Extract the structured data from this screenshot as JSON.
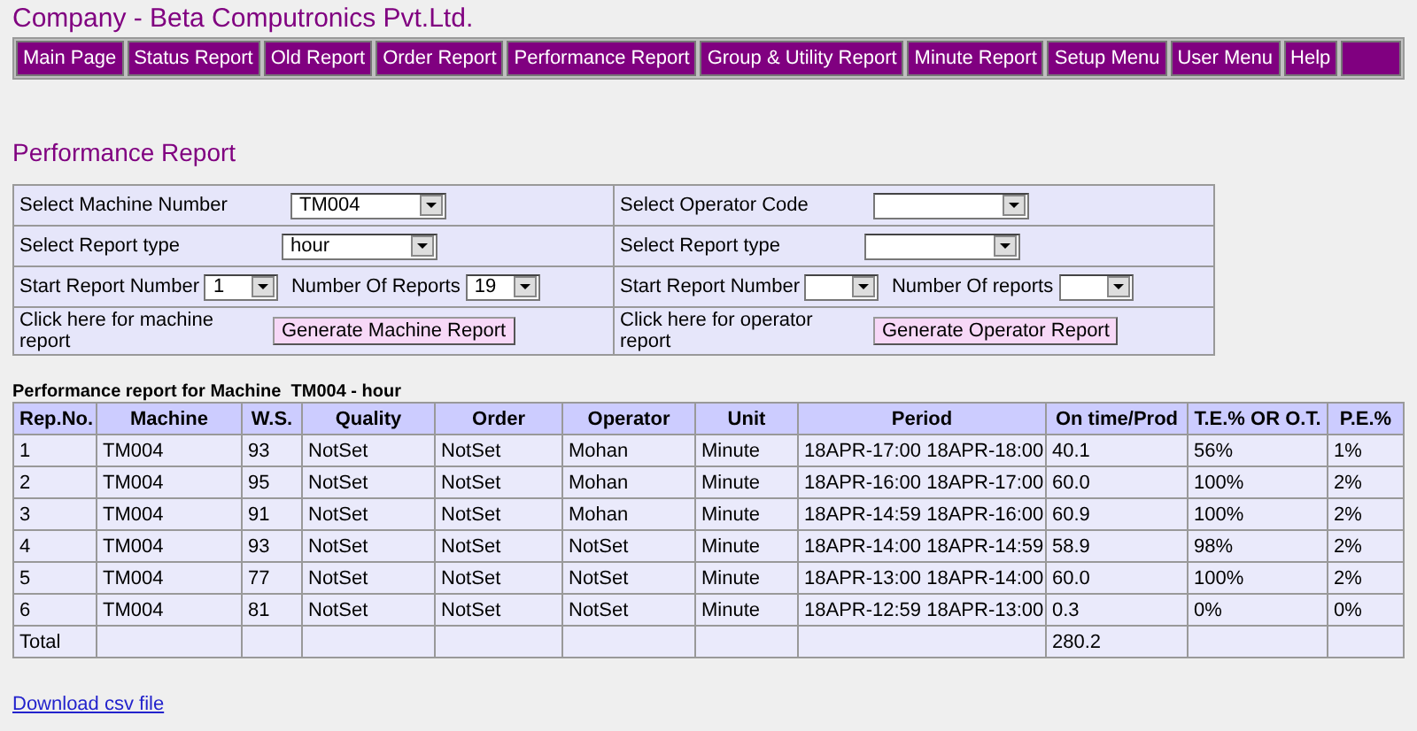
{
  "company_title": "Company - Beta Computronics Pvt.Ltd.",
  "nav": [
    {
      "label": "Main Page"
    },
    {
      "label": "Status Report"
    },
    {
      "label": "Old Report"
    },
    {
      "label": "Order Report"
    },
    {
      "label": "Performance Report"
    },
    {
      "label": "Group & Utility Report"
    },
    {
      "label": "Minute Report"
    },
    {
      "label": "Setup Menu"
    },
    {
      "label": "User Menu"
    },
    {
      "label": "Help"
    }
  ],
  "page_title": "Performance Report",
  "form": [
    {
      "left": [
        {
          "kind": "label",
          "text": "Select Machine Number"
        },
        {
          "kind": "select",
          "value": "TM004"
        }
      ],
      "right": [
        {
          "kind": "label",
          "text": "Select Operator Code"
        },
        {
          "kind": "select"
        }
      ]
    },
    {
      "left": [
        {
          "kind": "label",
          "text": "Select Report type"
        },
        {
          "kind": "select",
          "value": "hour"
        }
      ],
      "right": [
        {
          "kind": "label",
          "text": "Select Report type"
        },
        {
          "kind": "select"
        }
      ]
    },
    {
      "left": [
        {
          "kind": "inline-label",
          "text": "Start Report Number"
        },
        {
          "kind": "short-select",
          "value": "1"
        },
        {
          "kind": "inline-label",
          "text": "Number Of Reports"
        },
        {
          "kind": "short-select",
          "value": "19"
        }
      ],
      "right": [
        {
          "kind": "inline-label",
          "text": "Start Report Number"
        },
        {
          "kind": "short-select"
        },
        {
          "kind": "inline-label",
          "text": "Number Of reports"
        },
        {
          "kind": "short-select"
        }
      ]
    },
    {
      "left": [
        {
          "kind": "label",
          "text": "Click here for machine report"
        },
        {
          "kind": "button",
          "text": "Generate Machine Report"
        }
      ],
      "right": [
        {
          "kind": "label",
          "text": "Click here for operator report"
        },
        {
          "kind": "button",
          "text": "Generate Operator Report"
        }
      ]
    }
  ],
  "report": {
    "title": "Performance report for Machine  TM004 - hour",
    "columns": [
      "Rep.No.",
      "Machine",
      "W.S.",
      "Quality",
      "Order",
      "Operator",
      "Unit",
      "Period",
      "On time/Prod",
      "T.E.% OR O.T.",
      "P.E.%"
    ],
    "rows": [
      [
        "1",
        "TM004",
        "93",
        "NotSet",
        "NotSet",
        "Mohan",
        "Minute",
        "18APR-17:00 18APR-18:00",
        "40.1",
        "56%",
        "1%"
      ],
      [
        "2",
        "TM004",
        "95",
        "NotSet",
        "NotSet",
        "Mohan",
        "Minute",
        "18APR-16:00 18APR-17:00",
        "60.0",
        "100%",
        "2%"
      ],
      [
        "3",
        "TM004",
        "91",
        "NotSet",
        "NotSet",
        "Mohan",
        "Minute",
        "18APR-14:59 18APR-16:00",
        "60.9",
        "100%",
        "2%"
      ],
      [
        "4",
        "TM004",
        "93",
        "NotSet",
        "NotSet",
        "NotSet",
        "Minute",
        "18APR-14:00 18APR-14:59",
        "58.9",
        "98%",
        "2%"
      ],
      [
        "5",
        "TM004",
        "77",
        "NotSet",
        "NotSet",
        "NotSet",
        "Minute",
        "18APR-13:00 18APR-14:00",
        "60.0",
        "100%",
        "2%"
      ],
      [
        "6",
        "TM004",
        "81",
        "NotSet",
        "NotSet",
        "NotSet",
        "Minute",
        "18APR-12:59 18APR-13:00",
        "0.3",
        "0%",
        "0%"
      ]
    ],
    "total": {
      "label": "Total",
      "on_time_prod": "280.2"
    }
  },
  "download_link": "Download csv file"
}
